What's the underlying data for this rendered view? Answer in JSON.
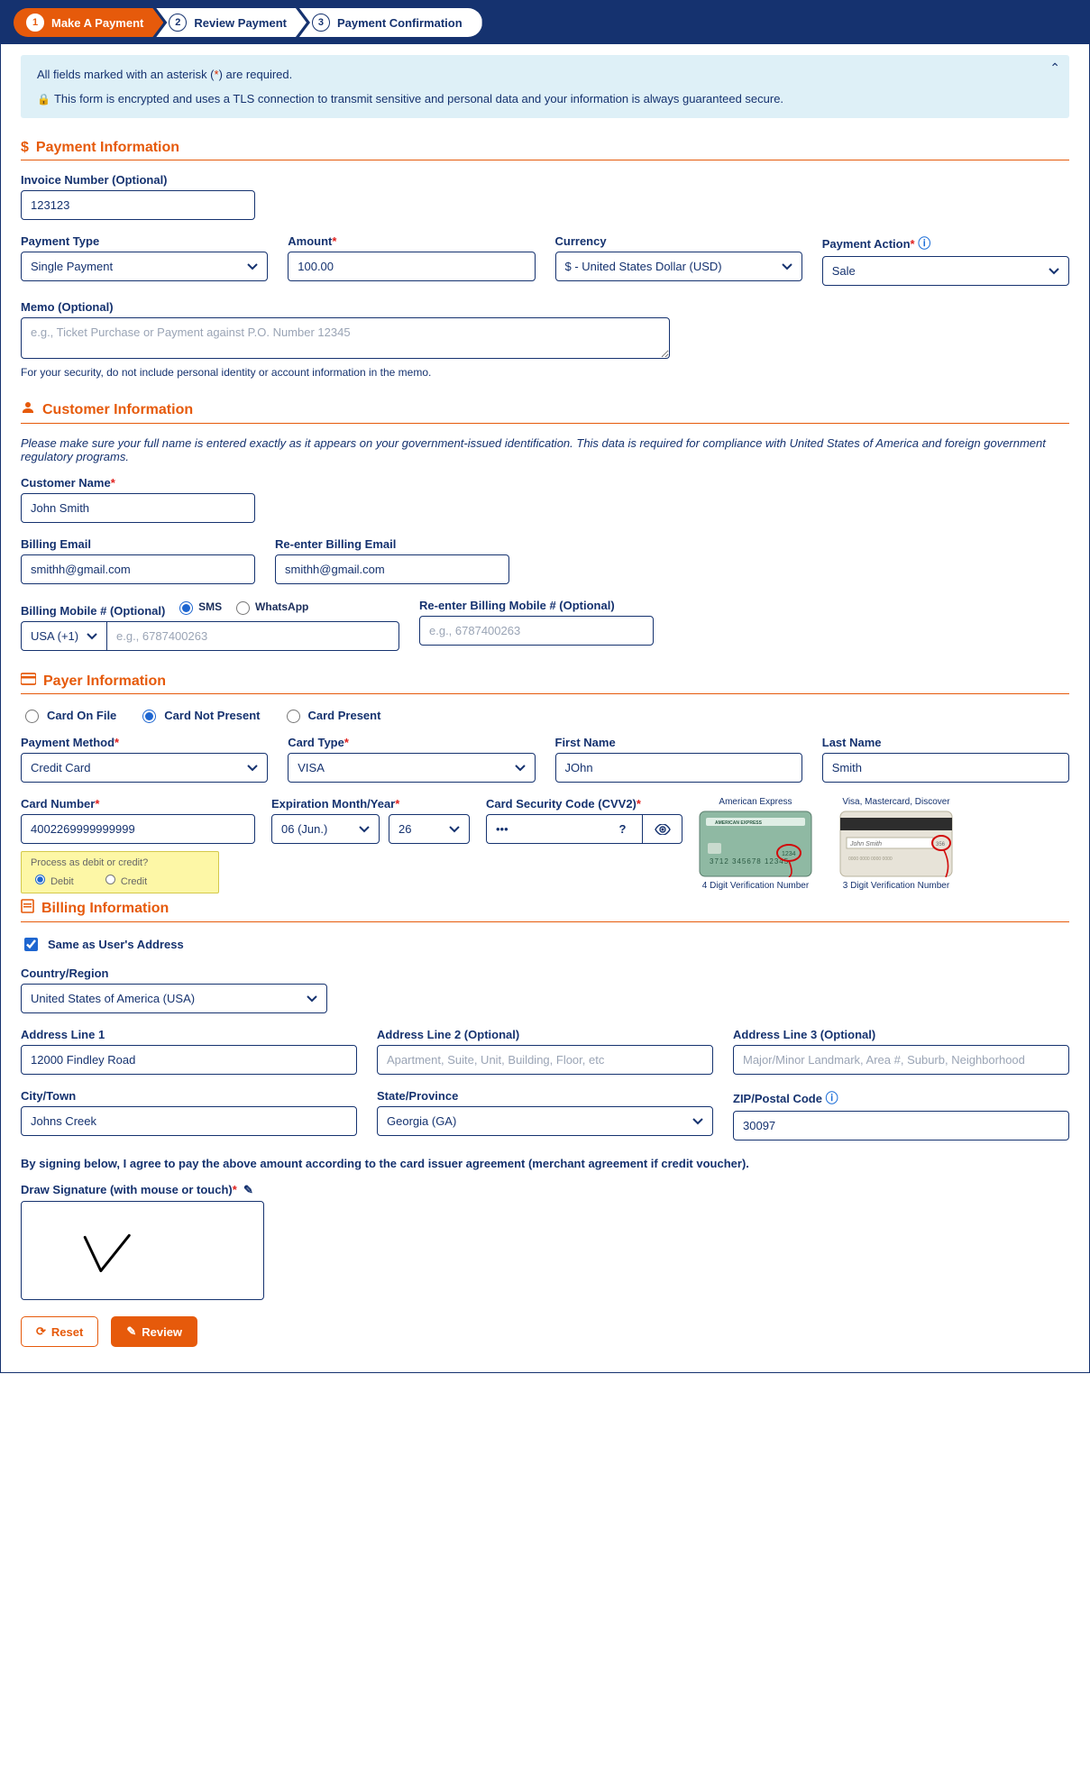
{
  "steps": {
    "s1": "Make A Payment",
    "s2": "Review Payment",
    "s3": "Payment Confirmation"
  },
  "notice": {
    "line1a": "All fields marked with an asterisk (",
    "line1b": ") are required.",
    "line2": "This form is encrypted and uses a TLS connection to transmit sensitive and personal data and your information is always guaranteed secure."
  },
  "payment": {
    "section": "Payment Information",
    "invoice_lbl": "Invoice Number (Optional)",
    "invoice_val": "123123",
    "type_lbl": "Payment Type",
    "type_val": "Single Payment",
    "amount_lbl": "Amount",
    "amount_val": "100.00",
    "currency_lbl": "Currency",
    "currency_val": "$ - United States Dollar (USD)",
    "action_lbl": "Payment Action",
    "action_val": "Sale",
    "memo_lbl": "Memo (Optional)",
    "memo_ph": "e.g., Ticket Purchase or Payment against P.O. Number 12345",
    "memo_hint": "For your security, do not include personal identity or account information in the memo."
  },
  "customer": {
    "section": "Customer Information",
    "note": "Please make sure your full name is entered exactly as it appears on your government-issued identification. This data is required for compliance with United States of America and foreign government regulatory programs.",
    "name_lbl": "Customer Name",
    "name_val": "John Smith",
    "email_lbl": "Billing Email",
    "email_val": "smithh@gmail.com",
    "email2_lbl": "Re-enter Billing Email",
    "email2_val": "smithh@gmail.com",
    "mobile_lbl": "Billing Mobile # (Optional)",
    "sms": "SMS",
    "wa": "WhatsApp",
    "cc_val": "USA (+1)",
    "mobile_ph": "e.g., 6787400263",
    "mobile2_lbl": "Re-enter Billing Mobile # (Optional)"
  },
  "payer": {
    "section": "Payer Information",
    "r1": "Card On File",
    "r2": "Card Not Present",
    "r3": "Card Present",
    "method_lbl": "Payment Method",
    "method_val": "Credit Card",
    "ctype_lbl": "Card Type",
    "ctype_val": "VISA",
    "fname_lbl": "First Name",
    "fname_val": "JOhn",
    "lname_lbl": "Last Name",
    "lname_val": "Smith",
    "cnum_lbl": "Card Number",
    "cnum_val": "4002269999999999",
    "exp_lbl": "Expiration Month/Year",
    "exp_m": "06 (Jun.)",
    "exp_y": "26",
    "cvv_lbl": "Card Security Code (CVV2)",
    "cvv_val": "•••",
    "dc_q": "Process as debit or credit?",
    "dc_d": "Debit",
    "dc_c": "Credit",
    "img1_top": "American Express",
    "img1_bot": "4 Digit Verification Number",
    "img2_top": "Visa, Mastercard, Discover",
    "img2_bot": "3 Digit Verification Number"
  },
  "billing": {
    "section": "Billing Information",
    "same": "Same as User's Address",
    "country_lbl": "Country/Region",
    "country_val": "United States of America (USA)",
    "a1_lbl": "Address Line 1",
    "a1_val": "12000 Findley Road",
    "a2_lbl": "Address Line 2 (Optional)",
    "a2_ph": "Apartment, Suite, Unit, Building, Floor, etc",
    "a3_lbl": "Address Line 3 (Optional)",
    "a3_ph": "Major/Minor Landmark, Area #, Suburb, Neighborhood",
    "city_lbl": "City/Town",
    "city_val": "Johns Creek",
    "state_lbl": "State/Province",
    "state_val": "Georgia (GA)",
    "zip_lbl": "ZIP/Postal Code",
    "zip_val": "30097",
    "agree": "By signing below, I agree to pay the above amount according to the card issuer agreement (merchant agreement if credit voucher).",
    "sig_lbl": "Draw Signature (with mouse or touch)"
  },
  "buttons": {
    "reset": "Reset",
    "review": "Review"
  }
}
